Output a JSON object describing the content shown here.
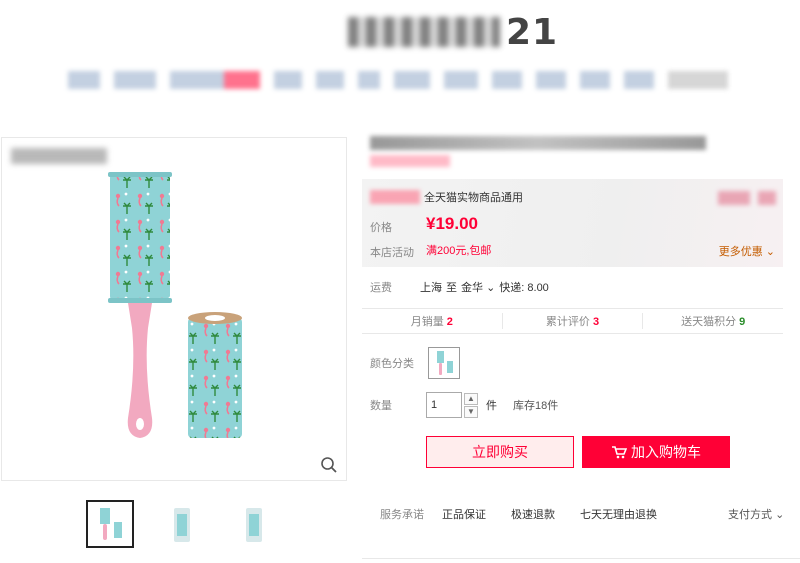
{
  "header": {
    "brand_visible": "21"
  },
  "price_panel": {
    "promo_text": "全天猫实物商品通用",
    "price_label": "价格",
    "price_value": "¥19.00",
    "activity_label": "本店活动",
    "activity_text": "满200元,包邮",
    "more_offers": "更多优惠"
  },
  "shipping": {
    "label": "运费",
    "from": "上海",
    "to_label": "至",
    "to": "金华",
    "fee": "快递: 8.00"
  },
  "stats": [
    {
      "label": "月销量",
      "value": "2",
      "color": "red"
    },
    {
      "label": "累计评价",
      "value": "3",
      "color": "red"
    },
    {
      "label": "送天猫积分",
      "value": "9",
      "color": "green"
    }
  ],
  "color": {
    "label": "颜色分类"
  },
  "quantity": {
    "label": "数量",
    "value": "1",
    "unit": "件",
    "stock": "库存18件"
  },
  "actions": {
    "buy_now": "立即购买",
    "add_cart": "加入购物车"
  },
  "service": {
    "label": "服务承诺",
    "items": [
      "正品保证",
      "极速退款",
      "七天无理由退换"
    ],
    "pay_method": "支付方式"
  },
  "colors": {
    "accent": "#ff0036",
    "teal": "#8fd3d6",
    "pink_handle": "#f2a9c0"
  }
}
